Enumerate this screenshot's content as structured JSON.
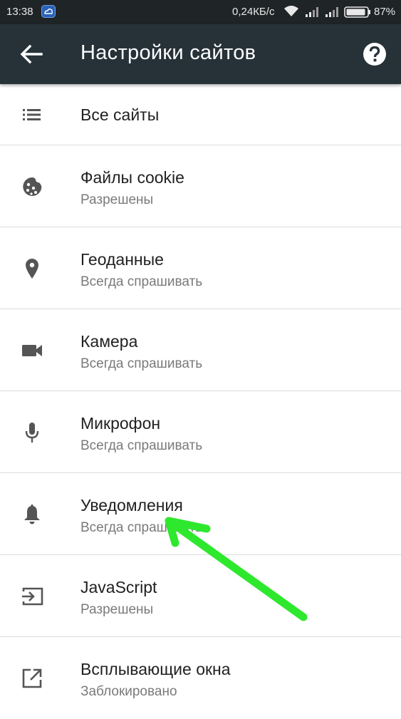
{
  "status_bar": {
    "time": "13:38",
    "net_speed": "0,24КБ/с",
    "battery": "87%"
  },
  "app_bar": {
    "title": "Настройки сайтов",
    "back_icon": "arrow-back-icon",
    "help_icon": "help-icon"
  },
  "items": [
    {
      "title": "Все сайты",
      "subtitle": "",
      "icon": "list-icon"
    },
    {
      "title": "Файлы cookie",
      "subtitle": "Разрешены",
      "icon": "cookie-icon"
    },
    {
      "title": "Геоданные",
      "subtitle": "Всегда спрашивать",
      "icon": "location-pin-icon"
    },
    {
      "title": "Камера",
      "subtitle": "Всегда спрашивать",
      "icon": "camera-icon"
    },
    {
      "title": "Микрофон",
      "subtitle": "Всегда спрашивать",
      "icon": "microphone-icon"
    },
    {
      "title": "Уведомления",
      "subtitle": "Всегда спрашивать",
      "icon": "bell-icon"
    },
    {
      "title": "JavaScript",
      "subtitle": "Разрешены",
      "icon": "javascript-icon"
    },
    {
      "title": "Всплывающие окна",
      "subtitle": "Заблокировано",
      "icon": "open-in-new-icon"
    }
  ],
  "colors": {
    "app_bar": "#263238",
    "status_bar": "#1f2426",
    "annotation_arrow": "#2ee82e"
  }
}
